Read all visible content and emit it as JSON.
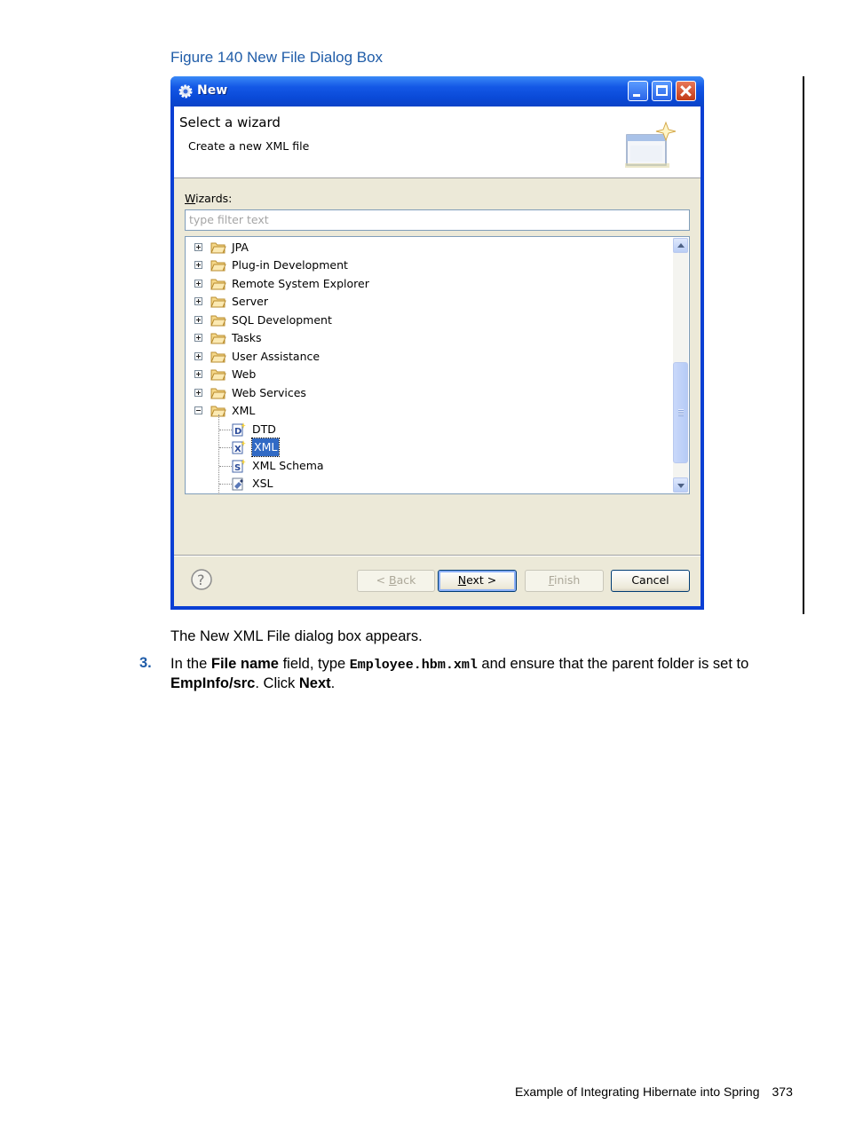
{
  "figure_caption": "Figure 140 New File Dialog Box",
  "dialog": {
    "title": "New",
    "header_title": "Select a wizard",
    "header_subtitle": "Create a new XML file",
    "wizards_label_u": "W",
    "wizards_label_rest": "izards:",
    "filter_placeholder": "type filter text",
    "tree": [
      {
        "label": "JPA"
      },
      {
        "label": "Plug-in Development"
      },
      {
        "label": "Remote System Explorer"
      },
      {
        "label": "Server"
      },
      {
        "label": "SQL Development"
      },
      {
        "label": "Tasks"
      },
      {
        "label": "User Assistance"
      },
      {
        "label": "Web"
      },
      {
        "label": "Web Services"
      },
      {
        "label": "XML"
      }
    ],
    "xml_children": [
      {
        "label": "DTD",
        "icon_letter": "D"
      },
      {
        "label": "XML",
        "icon_letter": "X"
      },
      {
        "label": "XML Schema",
        "icon_letter": "S"
      },
      {
        "label": "XSL",
        "icon_letter": ""
      }
    ],
    "buttons": {
      "back_prefix": "< ",
      "back_u": "B",
      "back_rest": "ack",
      "next_u": "N",
      "next_rest": "ext >",
      "finish_u": "F",
      "finish_rest": "inish",
      "cancel": "Cancel"
    }
  },
  "text": {
    "para": "The New XML File dialog box appears.",
    "step_number": "3.",
    "step_t1": "In the ",
    "step_b1": "File name",
    "step_t2": " field, type ",
    "step_code": "Employee.hbm.xml",
    "step_t3": " and ensure that the parent folder is set to ",
    "step_b2": "EmpInfo/src",
    "step_t4": ". Click ",
    "step_b3": "Next",
    "step_t5": "."
  },
  "footer": {
    "title": "Example of Integrating Hibernate into Spring",
    "page": "373"
  }
}
